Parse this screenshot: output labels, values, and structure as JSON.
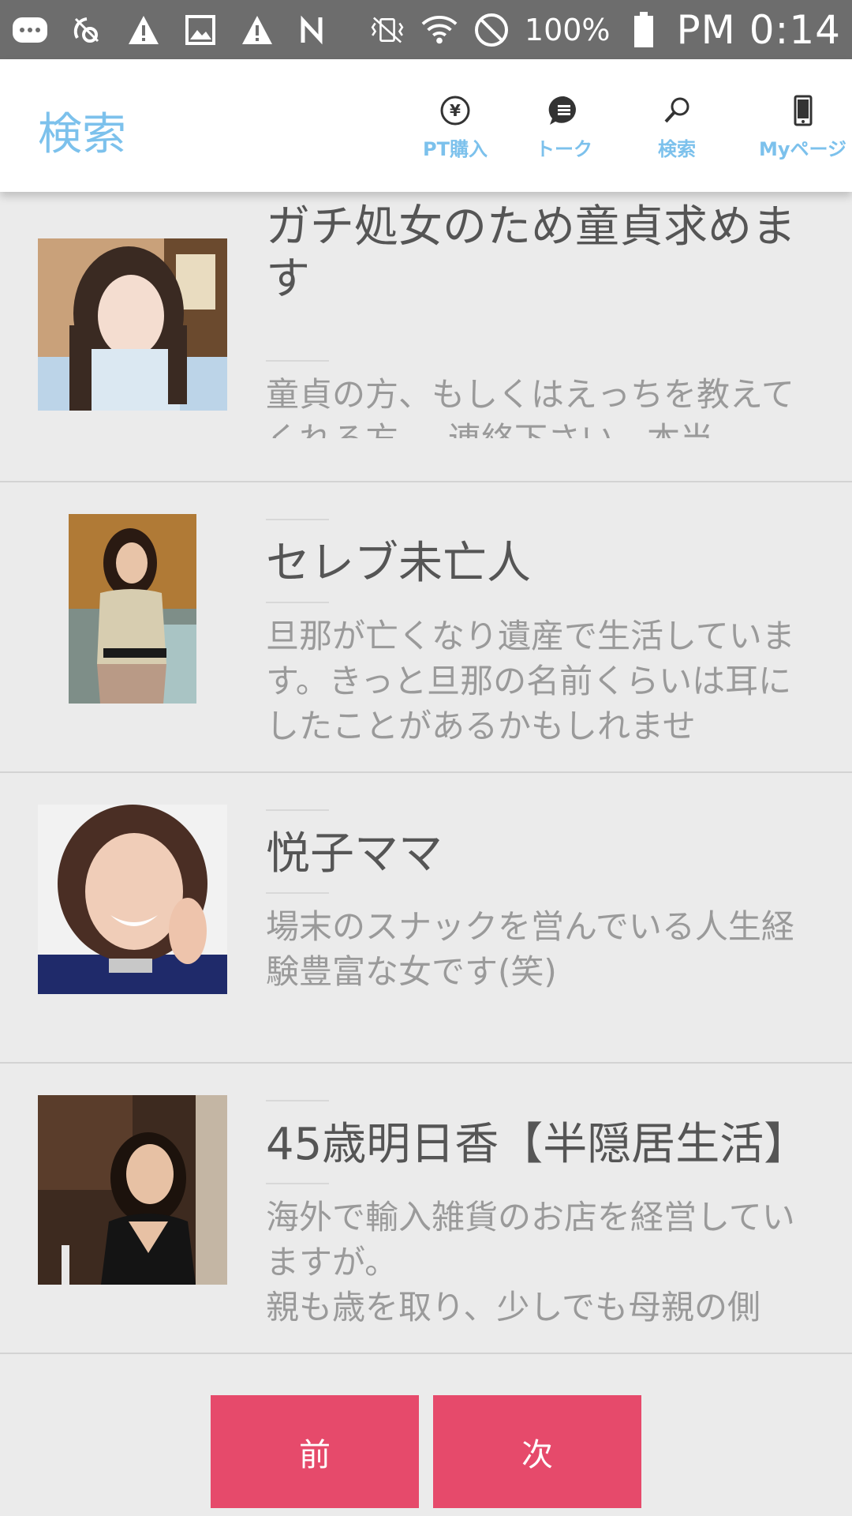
{
  "status_bar": {
    "icons_left": [
      "message-icon",
      "signal-off-icon",
      "warning-icon",
      "image-icon",
      "warning-icon",
      "nfc-icon"
    ],
    "icons_right": [
      "vibrate-icon",
      "wifi-icon",
      "do-not-disturb-icon"
    ],
    "battery": "100%",
    "time": "PM 0:14"
  },
  "header": {
    "title": "検索",
    "nav": [
      {
        "label": "PT購入",
        "icon": "yen-icon"
      },
      {
        "label": "トーク",
        "icon": "chat-icon"
      },
      {
        "label": "検索",
        "icon": "search-icon"
      },
      {
        "label": "Myページ",
        "icon": "phone-icon"
      }
    ]
  },
  "colors": {
    "accent": "#7cc1ec",
    "button": "#e64a6b",
    "background": "#ebebeb"
  },
  "items": [
    {
      "title": "ガチ処女のため童貞求めます",
      "desc": "童貞の方、もしくはえっちを教えてくれる方、、連絡下さい。本当"
    },
    {
      "title": "セレブ未亡人",
      "desc": "旦那が亡くなり遺産で生活しています。きっと旦那の名前くらいは耳にしたことがあるかもしれませ"
    },
    {
      "title": "悦子ママ",
      "desc": "場末のスナックを営んでいる人生経験豊富な女です(笑)"
    },
    {
      "title": "45歳明日香【半隠居生活】",
      "desc": "海外で輸入雑貨のお店を経営していますが。\n親も歳を取り、少しでも母親の側"
    }
  ],
  "pager": {
    "prev": "前",
    "next": "次"
  }
}
